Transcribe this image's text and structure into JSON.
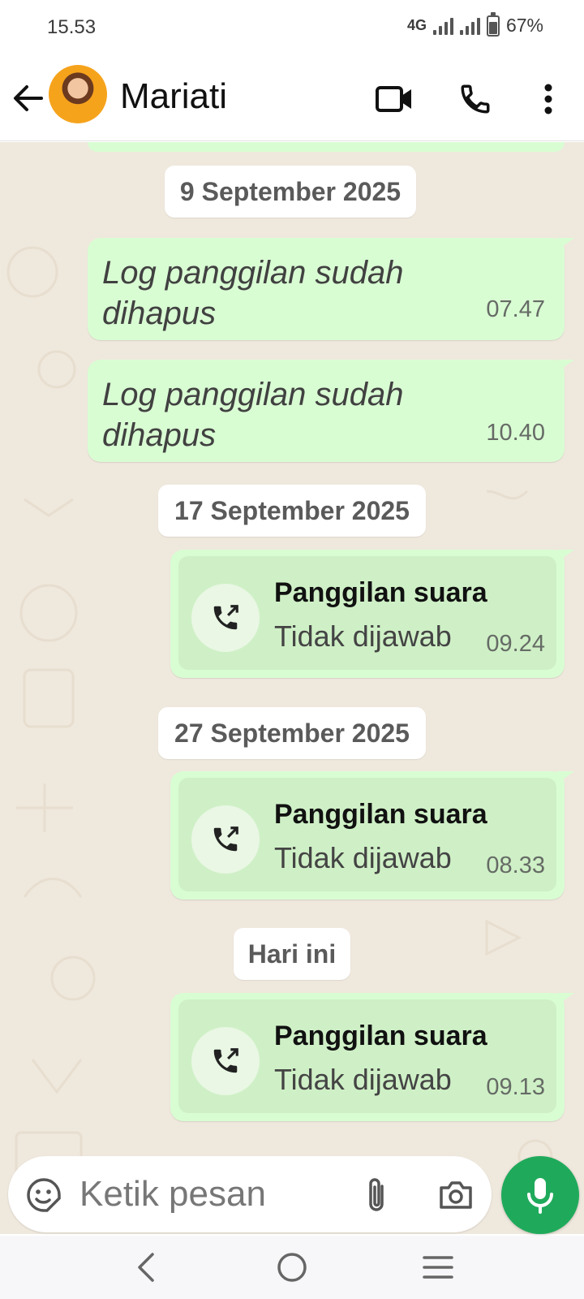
{
  "status_bar": {
    "time": "15.53",
    "network": "4G",
    "battery_percent": "67%",
    "battery_level": 0.67
  },
  "header": {
    "contact_name": "Mariati",
    "icons": [
      "back-arrow-icon",
      "video-call-icon",
      "voice-call-icon",
      "more-vert-icon"
    ]
  },
  "chat": {
    "date_chips": [
      "9 September 2025",
      "17 September 2025",
      "27 September 2025",
      "Hari ini"
    ],
    "deleted_messages": [
      {
        "text": "Log panggilan sudah dihapus",
        "time": "07.47"
      },
      {
        "text": "Log panggilan sudah dihapus",
        "time": "10.40"
      }
    ],
    "calls": [
      {
        "title": "Panggilan suara",
        "status": "Tidak dijawab",
        "time": "09.24"
      },
      {
        "title": "Panggilan suara",
        "status": "Tidak dijawab",
        "time": "08.33"
      },
      {
        "title": "Panggilan suara",
        "status": "Tidak dijawab",
        "time": "09.13"
      }
    ]
  },
  "input": {
    "placeholder": "Ketik pesan"
  },
  "colors": {
    "outgoing_bubble": "#d9fdd3",
    "call_inner": "#cff0c6",
    "wallpaper": "#efe8dd",
    "mic_button": "#1faa5b"
  }
}
